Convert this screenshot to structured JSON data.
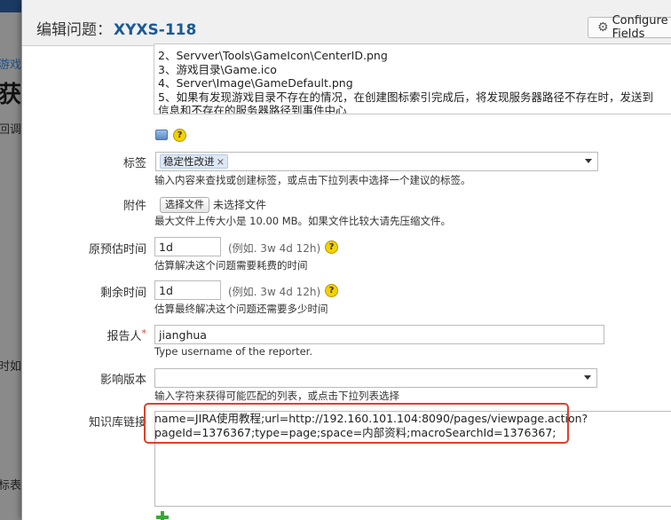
{
  "background": {
    "fragments": [
      "游戏",
      "获",
      "回调",
      "时如",
      "标表"
    ]
  },
  "dialog": {
    "title_prefix": "编辑问题：",
    "issue_key": "XYXS-118",
    "configure_label": "Configure Fields"
  },
  "description": {
    "lines": [
      "2、Servver\\Tools\\GameIcon\\CenterID.png",
      "3、游戏目录\\Game.ico",
      "4、Server\\Image\\GameDefault.png",
      "5、如果有发现游戏目录不存在的情况，在创建图标索引完成后，将发现服务器路径不存在时，发送到",
      "信息和不存在的服务器路径到事件中心"
    ]
  },
  "labels_field": {
    "label": "标签",
    "tag": "稳定性改进",
    "remove": "×",
    "hint": "输入内容来查找或创建标签，或点击下拉列表中选择一个建议的标签。"
  },
  "attachment_field": {
    "label": "附件",
    "button": "选择文件",
    "status": "未选择文件",
    "hint": "最大文件上传大小是 10.00 MB。如果文件比较大请先压缩文件。"
  },
  "original_estimate": {
    "label": "原预估时间",
    "value": "1d",
    "example": "(例如. 3w 4d 12h)",
    "hint": "估算解决这个问题需要耗费的时间"
  },
  "remaining_estimate": {
    "label": "剩余时间",
    "value": "1d",
    "example": "(例如. 3w 4d 12h)",
    "hint": "估算最终解决这个问题还需要多少时间"
  },
  "reporter": {
    "label": "报告人",
    "required_mark": "*",
    "value": "jianghua",
    "hint": "Type username of the reporter."
  },
  "affects_version": {
    "label": "影响版本",
    "hint": "输入字符来获得可能匹配的列表，或点击下拉列表选择"
  },
  "kb_link": {
    "label": "知识库链接",
    "line1": "name=JIRA使用教程;url=http://192.160.101.104:8090/pages/viewpage.action?",
    "line2": "pageId=1376367;type=page;space=内部资料;macroSearchId=1376367;"
  },
  "icons": {
    "help": "?",
    "help_icon_name": "help-icon",
    "wiki_icon_name": "wiki-markup-icon",
    "gear": "⚙"
  },
  "colors": {
    "issue_key": "#1a5a96",
    "highlight": "#e0402a",
    "required": "#d04437",
    "add": "#3aa63a"
  }
}
